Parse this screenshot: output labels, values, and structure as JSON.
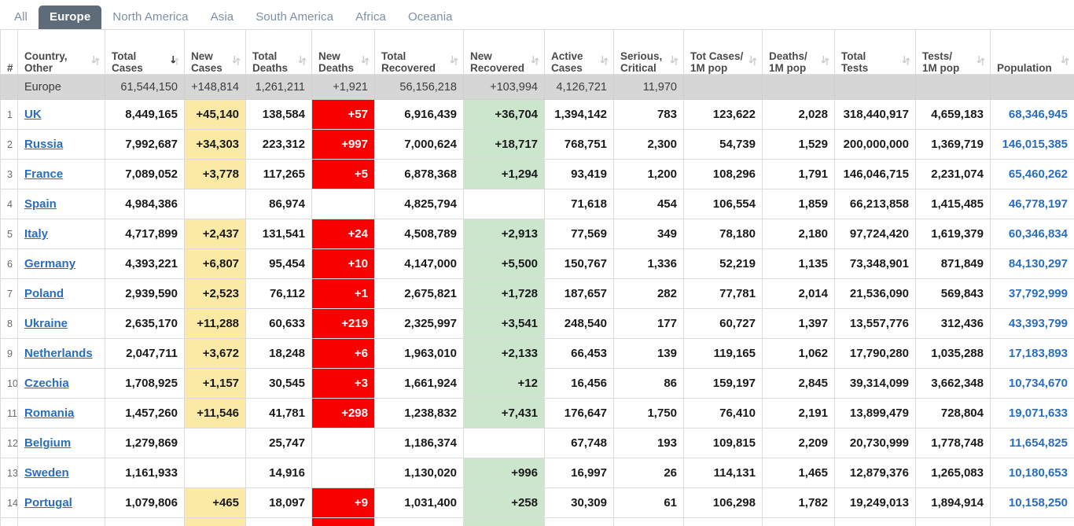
{
  "tabs": [
    {
      "label": "All",
      "active": false
    },
    {
      "label": "Europe",
      "active": true
    },
    {
      "label": "North America",
      "active": false
    },
    {
      "label": "Asia",
      "active": false
    },
    {
      "label": "South America",
      "active": false
    },
    {
      "label": "Africa",
      "active": false
    },
    {
      "label": "Oceania",
      "active": false
    }
  ],
  "colors": {
    "tab_active_bg": "#5e6b78",
    "tab_text": "#7d8fa6",
    "new_cases_bg": "#fbe9a6",
    "new_deaths_bg": "#fb0000",
    "new_recovered_bg": "#cce5cd",
    "summary_row_bg": "#d6d6d6",
    "link": "#2a6ebb"
  },
  "table": {
    "columns": [
      {
        "id": "rank",
        "label": "#",
        "line1": "#",
        "line2": "",
        "sort": "none"
      },
      {
        "id": "country",
        "label": "Country, Other",
        "line1": "Country,",
        "line2": "Other",
        "sort": "both"
      },
      {
        "id": "total_cases",
        "label": "Total Cases",
        "line1": "Total",
        "line2": "Cases",
        "sort": "desc"
      },
      {
        "id": "new_cases",
        "label": "New Cases",
        "line1": "New",
        "line2": "Cases",
        "sort": "both"
      },
      {
        "id": "total_deaths",
        "label": "Total Deaths",
        "line1": "Total",
        "line2": "Deaths",
        "sort": "both"
      },
      {
        "id": "new_deaths",
        "label": "New Deaths",
        "line1": "New",
        "line2": "Deaths",
        "sort": "both"
      },
      {
        "id": "total_recovered",
        "label": "Total Recovered",
        "line1": "Total",
        "line2": "Recovered",
        "sort": "both"
      },
      {
        "id": "new_recovered",
        "label": "New Recovered",
        "line1": "New",
        "line2": "Recovered",
        "sort": "both"
      },
      {
        "id": "active_cases",
        "label": "Active Cases",
        "line1": "Active",
        "line2": "Cases",
        "sort": "both"
      },
      {
        "id": "serious_critical",
        "label": "Serious, Critical",
        "line1": "Serious,",
        "line2": "Critical",
        "sort": "both"
      },
      {
        "id": "tot_cases_1m",
        "label": "Tot Cases/1M pop",
        "line1": "Tot Cases/",
        "line2": "1M pop",
        "sort": "both"
      },
      {
        "id": "deaths_1m",
        "label": "Deaths/1M pop",
        "line1": "Deaths/",
        "line2": "1M pop",
        "sort": "both"
      },
      {
        "id": "total_tests",
        "label": "Total Tests",
        "line1": "Total",
        "line2": "Tests",
        "sort": "both"
      },
      {
        "id": "tests_1m",
        "label": "Tests/1M pop",
        "line1": "Tests/",
        "line2": "1M pop",
        "sort": "both"
      },
      {
        "id": "population",
        "label": "Population",
        "line1": "",
        "line2": "Population",
        "sort": "both"
      }
    ],
    "summary": {
      "rank": "",
      "country": "Europe",
      "total_cases": "61,544,150",
      "new_cases": "+148,814",
      "total_deaths": "1,261,211",
      "new_deaths": "+1,921",
      "total_recovered": "56,156,218",
      "new_recovered": "+103,994",
      "active_cases": "4,126,721",
      "serious_critical": "11,970",
      "tot_cases_1m": "",
      "deaths_1m": "",
      "total_tests": "",
      "tests_1m": "",
      "population": ""
    },
    "rows": [
      {
        "rank": "1",
        "country": "UK",
        "total_cases": "8,449,165",
        "new_cases": "+45,140",
        "total_deaths": "138,584",
        "new_deaths": "+57",
        "total_recovered": "6,916,439",
        "new_recovered": "+36,704",
        "active_cases": "1,394,142",
        "serious_critical": "783",
        "tot_cases_1m": "123,622",
        "deaths_1m": "2,028",
        "total_tests": "318,440,917",
        "tests_1m": "4,659,183",
        "population": "68,346,945"
      },
      {
        "rank": "2",
        "country": "Russia",
        "total_cases": "7,992,687",
        "new_cases": "+34,303",
        "total_deaths": "223,312",
        "new_deaths": "+997",
        "total_recovered": "7,000,624",
        "new_recovered": "+18,717",
        "active_cases": "768,751",
        "serious_critical": "2,300",
        "tot_cases_1m": "54,739",
        "deaths_1m": "1,529",
        "total_tests": "200,000,000",
        "tests_1m": "1,369,719",
        "population": "146,015,385"
      },
      {
        "rank": "3",
        "country": "France",
        "total_cases": "7,089,052",
        "new_cases": "+3,778",
        "total_deaths": "117,265",
        "new_deaths": "+5",
        "total_recovered": "6,878,368",
        "new_recovered": "+1,294",
        "active_cases": "93,419",
        "serious_critical": "1,200",
        "tot_cases_1m": "108,296",
        "deaths_1m": "1,791",
        "total_tests": "146,046,715",
        "tests_1m": "2,231,074",
        "population": "65,460,262"
      },
      {
        "rank": "4",
        "country": "Spain",
        "total_cases": "4,984,386",
        "new_cases": "",
        "total_deaths": "86,974",
        "new_deaths": "",
        "total_recovered": "4,825,794",
        "new_recovered": "",
        "active_cases": "71,618",
        "serious_critical": "454",
        "tot_cases_1m": "106,554",
        "deaths_1m": "1,859",
        "total_tests": "66,213,858",
        "tests_1m": "1,415,485",
        "population": "46,778,197"
      },
      {
        "rank": "5",
        "country": "Italy",
        "total_cases": "4,717,899",
        "new_cases": "+2,437",
        "total_deaths": "131,541",
        "new_deaths": "+24",
        "total_recovered": "4,508,789",
        "new_recovered": "+2,913",
        "active_cases": "77,569",
        "serious_critical": "349",
        "tot_cases_1m": "78,180",
        "deaths_1m": "2,180",
        "total_tests": "97,724,420",
        "tests_1m": "1,619,379",
        "population": "60,346,834"
      },
      {
        "rank": "6",
        "country": "Germany",
        "total_cases": "4,393,221",
        "new_cases": "+6,807",
        "total_deaths": "95,454",
        "new_deaths": "+10",
        "total_recovered": "4,147,000",
        "new_recovered": "+5,500",
        "active_cases": "150,767",
        "serious_critical": "1,336",
        "tot_cases_1m": "52,219",
        "deaths_1m": "1,135",
        "total_tests": "73,348,901",
        "tests_1m": "871,849",
        "population": "84,130,297"
      },
      {
        "rank": "7",
        "country": "Poland",
        "total_cases": "2,939,590",
        "new_cases": "+2,523",
        "total_deaths": "76,112",
        "new_deaths": "+1",
        "total_recovered": "2,675,821",
        "new_recovered": "+1,728",
        "active_cases": "187,657",
        "serious_critical": "282",
        "tot_cases_1m": "77,781",
        "deaths_1m": "2,014",
        "total_tests": "21,536,090",
        "tests_1m": "569,843",
        "population": "37,792,999"
      },
      {
        "rank": "8",
        "country": "Ukraine",
        "total_cases": "2,635,170",
        "new_cases": "+11,288",
        "total_deaths": "60,633",
        "new_deaths": "+219",
        "total_recovered": "2,325,997",
        "new_recovered": "+3,541",
        "active_cases": "248,540",
        "serious_critical": "177",
        "tot_cases_1m": "60,727",
        "deaths_1m": "1,397",
        "total_tests": "13,557,776",
        "tests_1m": "312,436",
        "population": "43,393,799"
      },
      {
        "rank": "9",
        "country": "Netherlands",
        "total_cases": "2,047,711",
        "new_cases": "+3,672",
        "total_deaths": "18,248",
        "new_deaths": "+6",
        "total_recovered": "1,963,010",
        "new_recovered": "+2,133",
        "active_cases": "66,453",
        "serious_critical": "139",
        "tot_cases_1m": "119,165",
        "deaths_1m": "1,062",
        "total_tests": "17,790,280",
        "tests_1m": "1,035,288",
        "population": "17,183,893"
      },
      {
        "rank": "10",
        "country": "Czechia",
        "total_cases": "1,708,925",
        "new_cases": "+1,157",
        "total_deaths": "30,545",
        "new_deaths": "+3",
        "total_recovered": "1,661,924",
        "new_recovered": "+12",
        "active_cases": "16,456",
        "serious_critical": "86",
        "tot_cases_1m": "159,197",
        "deaths_1m": "2,845",
        "total_tests": "39,314,099",
        "tests_1m": "3,662,348",
        "population": "10,734,670"
      },
      {
        "rank": "11",
        "country": "Romania",
        "total_cases": "1,457,260",
        "new_cases": "+11,546",
        "total_deaths": "41,781",
        "new_deaths": "+298",
        "total_recovered": "1,238,832",
        "new_recovered": "+7,431",
        "active_cases": "176,647",
        "serious_critical": "1,750",
        "tot_cases_1m": "76,410",
        "deaths_1m": "2,191",
        "total_tests": "13,899,479",
        "tests_1m": "728,804",
        "population": "19,071,633"
      },
      {
        "rank": "12",
        "country": "Belgium",
        "total_cases": "1,279,869",
        "new_cases": "",
        "total_deaths": "25,747",
        "new_deaths": "",
        "total_recovered": "1,186,374",
        "new_recovered": "",
        "active_cases": "67,748",
        "serious_critical": "193",
        "tot_cases_1m": "109,815",
        "deaths_1m": "2,209",
        "total_tests": "20,730,999",
        "tests_1m": "1,778,748",
        "population": "11,654,825"
      },
      {
        "rank": "13",
        "country": "Sweden",
        "total_cases": "1,161,933",
        "new_cases": "",
        "total_deaths": "14,916",
        "new_deaths": "",
        "total_recovered": "1,130,020",
        "new_recovered": "+996",
        "active_cases": "16,997",
        "serious_critical": "26",
        "tot_cases_1m": "114,131",
        "deaths_1m": "1,465",
        "total_tests": "12,879,376",
        "tests_1m": "1,265,083",
        "population": "10,180,653"
      },
      {
        "rank": "14",
        "country": "Portugal",
        "total_cases": "1,079,806",
        "new_cases": "+465",
        "total_deaths": "18,097",
        "new_deaths": "+9",
        "total_recovered": "1,031,400",
        "new_recovered": "+258",
        "active_cases": "30,309",
        "serious_critical": "61",
        "tot_cases_1m": "106,298",
        "deaths_1m": "1,782",
        "total_tests": "19,249,013",
        "tests_1m": "1,894,914",
        "population": "10,158,250"
      }
    ]
  }
}
